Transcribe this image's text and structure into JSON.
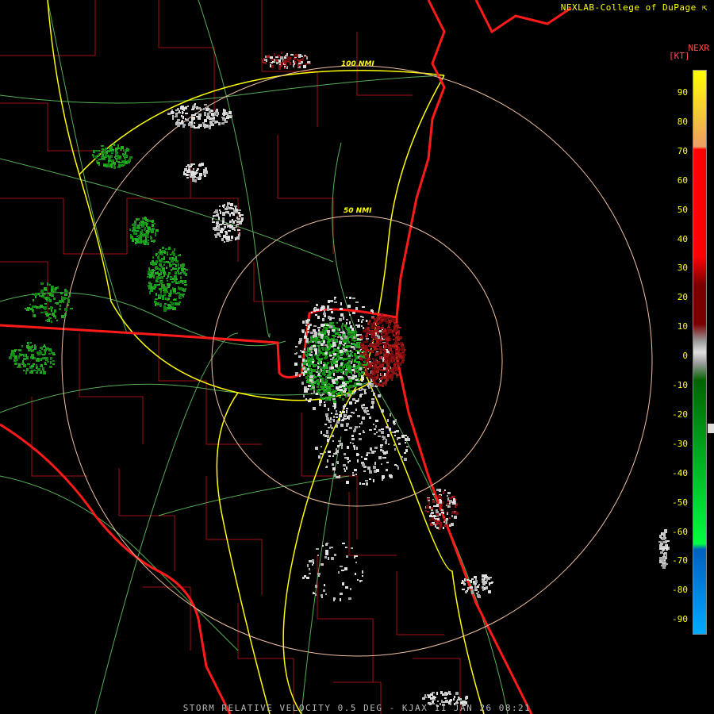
{
  "credit": "NEXLAB-College of DuPage",
  "credit_icon": "cursor-arrow-icon",
  "legend": {
    "title": "NEXR",
    "unit": "[KT]",
    "ticks": [
      "90",
      "80",
      "70",
      "60",
      "50",
      "40",
      "30",
      "20",
      "10",
      "0",
      "-10",
      "-20",
      "-30",
      "-40",
      "-50",
      "-60",
      "-70",
      "-80",
      "-90"
    ],
    "colors": {
      "top": "#ffff00",
      "orange": "#f0a060",
      "red": "#ff0000",
      "dark_red": "#7a0000",
      "gray": "#9a9a9a",
      "dark_green": "#006400",
      "bright_green": "#00ff40",
      "blue": "#0060c0",
      "light_blue": "#00aaff"
    }
  },
  "rings": [
    {
      "label": "50 NMI"
    },
    {
      "label": "100 NMI"
    }
  ],
  "footer": "STORM RELATIVE VELOCITY 0.5 DEG - KJAX 11 JAN 26 08:21",
  "colors": {
    "background": "#000000",
    "county_lines": "#a01010",
    "state_lines": "#ff1a1a",
    "highways": "#ffff00",
    "roads": "#66cc66",
    "ring_color": "#f0c0a0",
    "velocity_green": "#1a9a1a",
    "velocity_gray": "#c8c8c8",
    "velocity_red": "#8a1010"
  }
}
